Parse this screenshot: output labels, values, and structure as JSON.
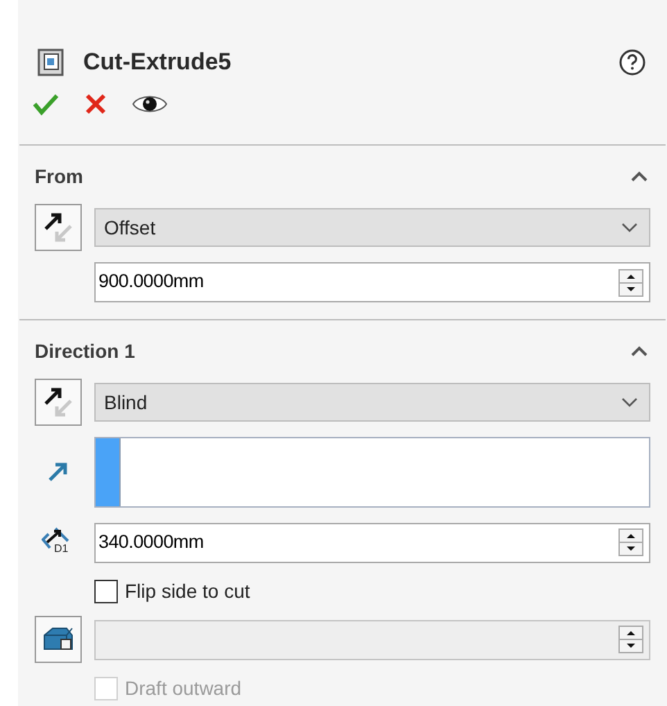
{
  "header": {
    "title": "Cut-Extrude5"
  },
  "sections": [
    {
      "title": "From",
      "expanded": true,
      "rows": [
        {
          "kind": "dropdown",
          "value": "Offset"
        },
        {
          "kind": "spin",
          "value": "900.0000mm"
        }
      ]
    },
    {
      "title": "Direction 1",
      "expanded": true,
      "rows": [
        {
          "kind": "dropdown",
          "value": "Blind"
        },
        {
          "kind": "selection"
        },
        {
          "kind": "spin",
          "value": "340.0000mm",
          "icon_label": "D1"
        },
        {
          "kind": "checkbox",
          "label": "Flip side to cut",
          "checked": false,
          "disabled": false
        },
        {
          "kind": "spin",
          "disabled": true
        },
        {
          "kind": "checkbox",
          "label": "Draft outward",
          "checked": false,
          "disabled": true
        }
      ]
    }
  ]
}
